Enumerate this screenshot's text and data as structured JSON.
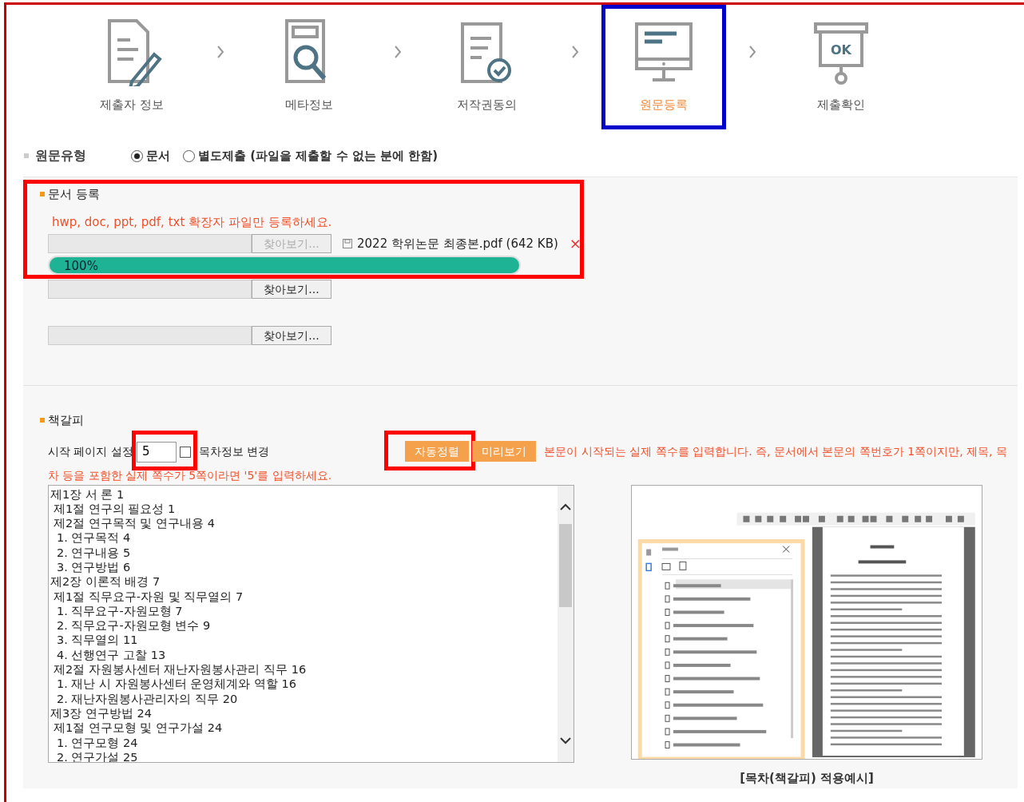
{
  "steps": [
    {
      "label": "제출자 정보",
      "selected": false,
      "highlighted": false
    },
    {
      "label": "메타정보",
      "selected": false,
      "highlighted": false
    },
    {
      "label": "저작권동의",
      "selected": false,
      "highlighted": false
    },
    {
      "label": "원문등록",
      "selected": true,
      "highlighted": true
    },
    {
      "label": "제출확인",
      "selected": false,
      "highlighted": false,
      "icon_text": "OK"
    }
  ],
  "source_type": {
    "label": "원문유형",
    "options": [
      {
        "label": "문서",
        "selected": true
      },
      {
        "label": "별도제출 (파일을 제출할 수 없는 분에 한함)",
        "selected": false
      }
    ]
  },
  "document_upload": {
    "title": "문서 등록",
    "highlighted": true,
    "notice": "hwp, doc, ppt, pdf, txt 확장자 파일만 등록하세요.",
    "files": [
      {
        "browse": "찾아보기...",
        "disabled": true,
        "file_name": "2022 학위논문 최종본.pdf (642 KB)",
        "remove": "×",
        "progress": {
          "level": 1,
          "reading": "100%"
        }
      },
      {
        "browse": "찾아보기...",
        "disabled": false
      },
      {
        "browse": "찾아보기...",
        "disabled": false
      }
    ]
  },
  "bookmarks": {
    "title": "책갈피",
    "start_page": {
      "label": "시작 페이지 설정",
      "value": "5",
      "highlighted": true
    },
    "toc_change": {
      "label": "목차정보 변경",
      "checked": false
    },
    "buttons": [
      {
        "label": "자동정렬",
        "highlighted": true
      },
      {
        "label": "미리보기"
      }
    ],
    "notice_lines": [
      "본문이 시작되는 실제 쪽수를 입력합니다. 즉, 문서에서 본문의 쪽번호가 1쪽이지만, 제목, 목",
      "차 등을 포함한 실제 쪽수가 5쪽이라면 '5'를 입력하세요."
    ],
    "toc": [
      {
        "text": "제1장 서 론 1",
        "children": [
          {
            "text": "제1절 연구의 필요성 1"
          },
          {
            "text": "제2절 연구목적 및 연구내용 4",
            "children": [
              {
                "text": "1. 연구목적 4"
              },
              {
                "text": "2. 연구내용 5"
              },
              {
                "text": "3. 연구방법 6"
              }
            ]
          }
        ]
      },
      {
        "text": "제2장 이론적 배경 7",
        "children": [
          {
            "text": "제1절 직무요구-자원 및 직무열의 7",
            "children": [
              {
                "text": "1. 직무요구-자원모형 7"
              },
              {
                "text": "2. 직무요구-자원모형 변수 9"
              },
              {
                "text": "3. 직무열의 11"
              },
              {
                "text": "4. 선행연구 고찰 13"
              }
            ]
          },
          {
            "text": "제2절 자원봉사센터 재난자원봉사관리 직무  16",
            "children": [
              {
                "text": "1. 재난 시 자원봉사센터 운영체계와 역할 16"
              },
              {
                "text": "2. 재난자원봉사관리자의 직무 20"
              }
            ]
          }
        ]
      },
      {
        "text": "제3장 연구방법 24",
        "children": [
          {
            "text": "제1절 연구모형 및 연구가설 24",
            "children": [
              {
                "text": "1. 연구모형 24"
              },
              {
                "text": "2. 연구가설 25"
              }
            ]
          }
        ]
      }
    ],
    "example_caption": "[목차(책갈피) 적용예시]"
  }
}
